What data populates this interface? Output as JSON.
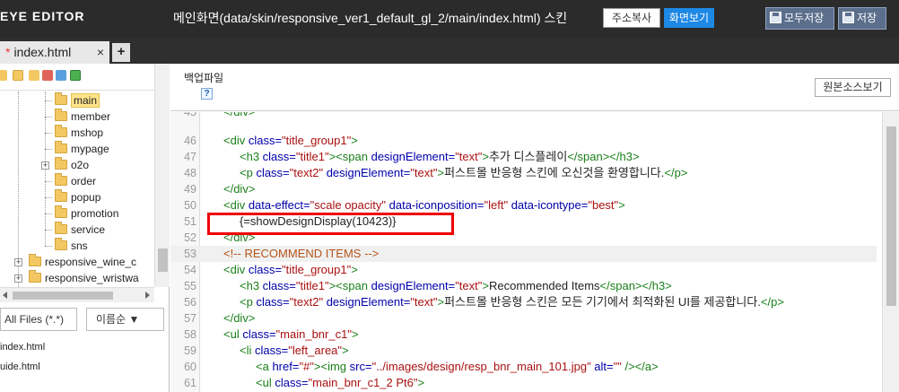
{
  "app": {
    "logo": "EYE EDITOR"
  },
  "header": {
    "page_title": "메인화면(data/skin/responsive_ver1_default_gl_2/main/index.html) 스킨",
    "copy_address": "주소복사",
    "view_page": "화면보기",
    "save_all": "모두저장",
    "save": "저장"
  },
  "tabs": {
    "active": {
      "modified_marker": "*",
      "label": "index.html",
      "close": "×"
    },
    "add": "+"
  },
  "tree": {
    "items": [
      {
        "label": "main",
        "selected": true
      },
      {
        "label": "member"
      },
      {
        "label": "mshop"
      },
      {
        "label": "mypage"
      },
      {
        "label": "o2o"
      },
      {
        "label": "order"
      },
      {
        "label": "popup"
      },
      {
        "label": "promotion"
      },
      {
        "label": "service"
      },
      {
        "label": "sns"
      }
    ],
    "root_items": [
      {
        "label": "responsive_wine_c"
      },
      {
        "label": "responsive_wristwa"
      }
    ]
  },
  "filters": {
    "file_type": "All Files (*.*)",
    "sort": "이름순 ▼"
  },
  "files": [
    {
      "label": "index.html"
    },
    {
      "label": "uide.html"
    }
  ],
  "editor_header": {
    "backup": "백업파일",
    "help": "?",
    "view_source": "원본소스보기"
  },
  "editor": {
    "lines": [
      {
        "n": "45",
        "code": "</div>"
      },
      {
        "n": "46",
        "code": ""
      },
      {
        "n": "47",
        "code": ""
      },
      {
        "n": "48",
        "code": ""
      },
      {
        "n": "49",
        "code": "</div>"
      },
      {
        "n": "50",
        "code": ""
      },
      {
        "n": "51",
        "code": "{=showDesignDisplay(10423)}"
      },
      {
        "n": "52",
        "code": "</div>"
      },
      {
        "n": "53",
        "code": "<!-- RECOMMEND ITEMS -->"
      },
      {
        "n": "54",
        "code": ""
      },
      {
        "n": "55",
        "code": ""
      },
      {
        "n": "56",
        "code": ""
      },
      {
        "n": "57",
        "code": "</div>"
      },
      {
        "n": "58",
        "code": ""
      },
      {
        "n": "59",
        "code": ""
      },
      {
        "n": "60",
        "code": ""
      },
      {
        "n": "61",
        "code": ""
      }
    ],
    "tokens": {
      "l46": {
        "t1": "<div ",
        "a1": "class=",
        "s1": "\"title_group1\"",
        "t2": ">"
      },
      "l47": {
        "t1": "<h3 ",
        "a1": "class=",
        "s1": "\"title1\"",
        "t2": "><span ",
        "a2": "designElement=",
        "s2": "\"text\"",
        "t3": ">",
        "x1": "추가 디스플레이",
        "t4": "</span></h3>"
      },
      "l48": {
        "t1": "<p ",
        "a1": "class=",
        "s1": "\"text2\"",
        "a2": " designElement=",
        "s2": "\"text\"",
        "t2": ">",
        "x1": "퍼스트몰 반응형 스킨에 오신것을 환영합니다.",
        "t3": "</p>"
      },
      "l50": {
        "t1": "<div ",
        "a1": "data-effect=",
        "s1": "\"scale opacity\"",
        "a2": " data-iconposition=",
        "s2": "\"left\"",
        "a3": " data-icontype=",
        "s3": "\"best\"",
        "t2": ">"
      },
      "l54": {
        "t1": "<div ",
        "a1": "class=",
        "s1": "\"title_group1\"",
        "t2": ">"
      },
      "l55": {
        "t1": "<h3 ",
        "a1": "class=",
        "s1": "\"title1\"",
        "t2": "><span ",
        "a2": "designElement=",
        "s2": "\"text\"",
        "t3": ">",
        "x1": "Recommended Items",
        "t4": "</span></h3>"
      },
      "l56": {
        "t1": "<p ",
        "a1": "class=",
        "s1": "\"text2\"",
        "a2": " designElement=",
        "s2": "\"text\"",
        "t2": ">",
        "x1": "퍼스트몰 반응형 스킨은 모든 기기에서 최적화된 UI를 제공합니다.",
        "t3": "</p>"
      },
      "l58": {
        "t1": "<ul ",
        "a1": "class=",
        "s1": "\"main_bnr_c1\"",
        "t2": ">"
      },
      "l59": {
        "t1": "<li ",
        "a1": "class=",
        "s1": "\"left_area\"",
        "t2": ">"
      },
      "l60": {
        "t1": "<a ",
        "a1": "href=",
        "s1": "\"#\"",
        "t2": "><img ",
        "a2": "src=",
        "s2": "\"../images/design/resp_bnr_main_101.jpg\"",
        "a3": " alt=",
        "s3": "\"\"",
        "t3": " /></a>"
      },
      "l61": {
        "t1": "<ul ",
        "a1": "class=",
        "s1": "\"main_bnr_c1_2 Pt6\"",
        "t2": ">"
      }
    }
  },
  "colors": {
    "topbar": "#2b2b2b",
    "accent_blue": "#1e88e5",
    "highlight_red": "#e00000",
    "tag": "#1a7f1a",
    "attr": "#0000aa",
    "string": "#aa1111",
    "comment": "#b5541a"
  }
}
